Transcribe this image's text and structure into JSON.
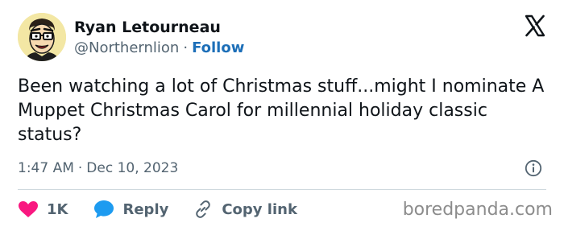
{
  "author": {
    "name": "Ryan Letourneau",
    "handle": "@Northernlion",
    "separator": "·",
    "follow_label": "Follow",
    "avatar_icon": "caricature-avatar"
  },
  "platform_icon": "x-logo-icon",
  "tweet": {
    "text": "Been watching a lot of Christmas stuff...might I nominate A Muppet Christmas Carol for millennial holiday classic status?",
    "time": "1:47 AM",
    "separator": "·",
    "date": "Dec 10, 2023"
  },
  "actions": {
    "like_count": "1K",
    "reply_label": "Reply",
    "copy_label": "Copy link"
  },
  "watermark": "boredpanda.com",
  "colors": {
    "like_heart": "#f91880",
    "reply_bubble": "#1d9bf0",
    "follow_link": "#1d6fb8",
    "text_primary": "#0f1419",
    "text_secondary": "#536471"
  }
}
